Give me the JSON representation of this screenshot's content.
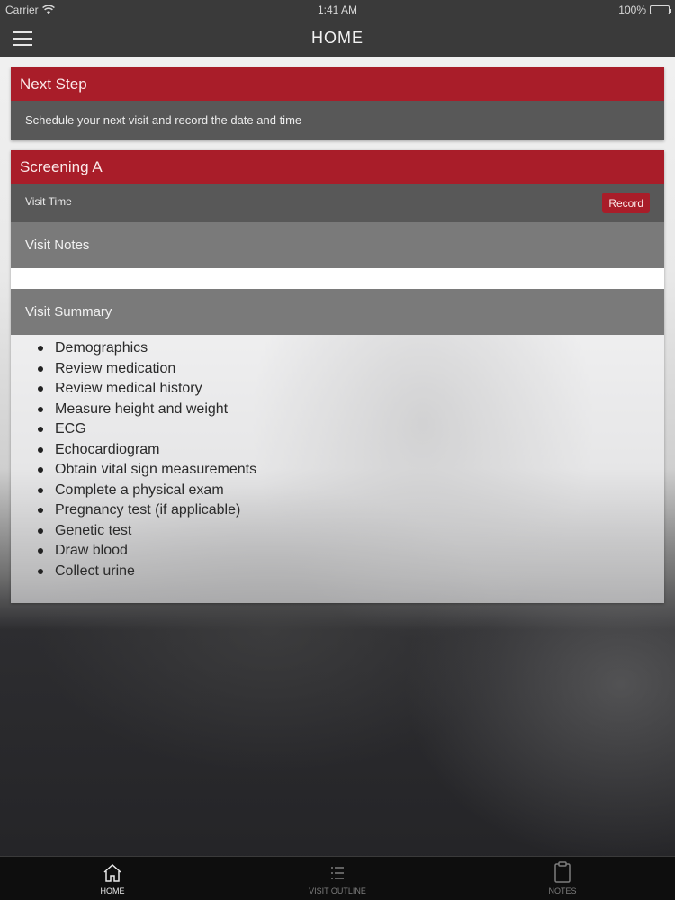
{
  "status_bar": {
    "carrier": "Carrier",
    "time": "1:41 AM",
    "battery": "100%",
    "battery_level": 1.0
  },
  "nav": {
    "title": "HOME",
    "menu_icon": "hamburger-icon"
  },
  "next_step": {
    "header": "Next Step",
    "text": "Schedule your next visit and record the date and time"
  },
  "screening": {
    "header": "Screening A",
    "visit_time_label": "Visit Time",
    "record_label": "Record",
    "visit_notes_label": "Visit Notes",
    "visit_notes_value": "",
    "visit_summary_label": "Visit Summary",
    "summary_items": [
      "Demographics",
      "Review medication",
      "Review medical history",
      "Measure height and weight",
      "ECG",
      "Echocardiogram",
      "Obtain vital sign measurements",
      "Complete a physical exam",
      "Pregnancy test (if applicable)",
      "Genetic test",
      "Draw blood",
      "Collect urine"
    ]
  },
  "tabs": [
    {
      "label": "HOME",
      "icon": "home-icon",
      "active": true
    },
    {
      "label": "VISIT OUTLINE",
      "icon": "list-icon",
      "active": false
    },
    {
      "label": "NOTES",
      "icon": "clipboard-icon",
      "active": false
    }
  ],
  "colors": {
    "accent": "#a91d29",
    "bar": "#3a3a3a",
    "row": "#585858",
    "section": "#7a7a7a"
  }
}
